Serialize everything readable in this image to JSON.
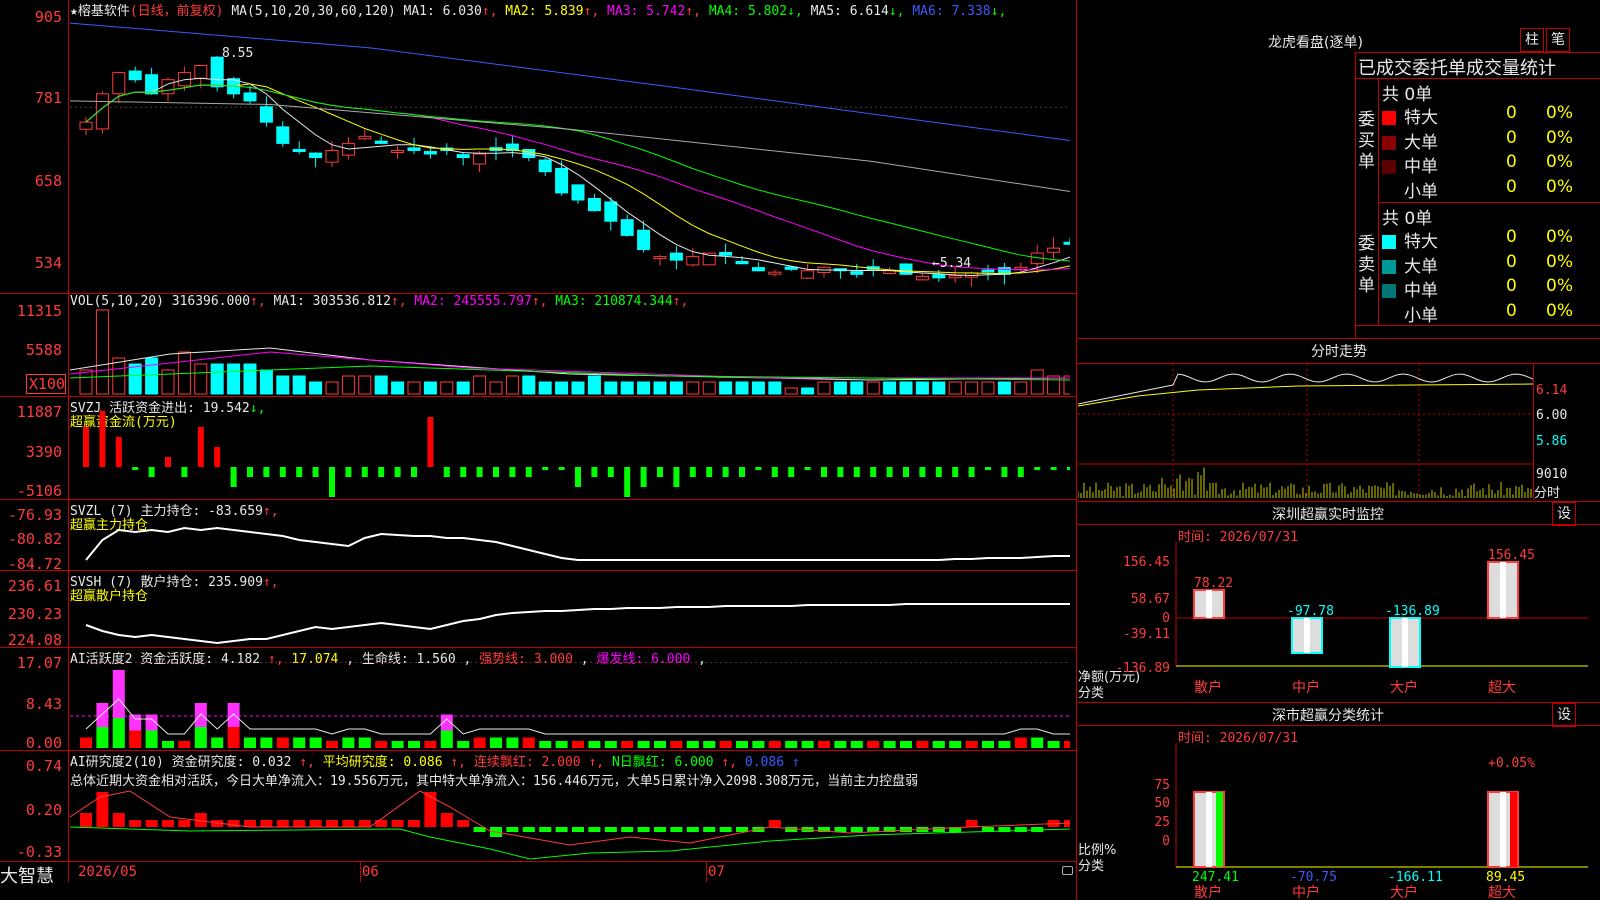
{
  "stock": {
    "name": "★榕基软件",
    "mode": "(日线，前复权)",
    "ma_label": "MA(5,10,20,30,60,120)",
    "ma": [
      {
        "k": "MA1:",
        "v": "6.030",
        "a": "↑",
        "color": "#e8e8e8"
      },
      {
        "k": "MA2:",
        "v": "5.839",
        "a": "↑",
        "color": "#ffff00"
      },
      {
        "k": "MA3:",
        "v": "5.742",
        "a": "↑",
        "color": "#ff00ff"
      },
      {
        "k": "MA4:",
        "v": "5.802",
        "a": "↓",
        "color": "#00ff00"
      },
      {
        "k": "MA5:",
        "v": "6.614",
        "a": "↓",
        "color": "#e8e8e8"
      },
      {
        "k": "MA6:",
        "v": "7.338",
        "a": "↓",
        "color": "#3b5bff"
      }
    ],
    "high_label": "8.55",
    "low_label": "←5.34"
  },
  "axes": {
    "price": [
      "905",
      "781",
      "658",
      "534"
    ],
    "vol": [
      "11315",
      "5588",
      "X100"
    ],
    "svzj": [
      "11887",
      "3390",
      "-5106"
    ],
    "svzl": [
      "-76.93",
      "-80.82",
      "-84.72"
    ],
    "svsh": [
      "236.61",
      "230.23",
      "224.08"
    ],
    "ai1": [
      "17.07",
      "8.43",
      "0.00"
    ],
    "ai2": [
      "0.74",
      "0.20",
      "-0.33"
    ]
  },
  "vol": {
    "label": "VOL(5,10,20)",
    "value": "316396.000",
    "ma": [
      {
        "k": "MA1:",
        "v": "303536.812",
        "a": "↑",
        "color": "#e8e8e8"
      },
      {
        "k": "MA2:",
        "v": "245555.797",
        "a": "↑",
        "color": "#ff00ff"
      },
      {
        "k": "MA3:",
        "v": "210874.344",
        "a": "↑",
        "color": "#00ff00"
      }
    ]
  },
  "svzj": {
    "l1": "SVZJ  活跃资金进出:",
    "v": "19.542",
    "a": "↓,",
    "l2": "超赢资金流(万元)"
  },
  "svzl": {
    "l1": "SVZL (7) 主力持仓:",
    "v": "-83.659",
    "a": "↑,",
    "l2": "超赢主力持仓"
  },
  "svsh": {
    "l1": "SVSH (7) 散户持仓:",
    "v": "235.909",
    "a": "↑,",
    "l2": "超赢散户持仓"
  },
  "ai1": {
    "items": [
      {
        "t": "AI活跃度2 资金活跃度:",
        "color": "#e8e8e8"
      },
      {
        "t": "4.182",
        "color": "#e8e8e8"
      },
      {
        "t": "↑,",
        "color": "#ff3b3b"
      },
      {
        "t": "17.074",
        "color": "#ffff00"
      },
      {
        "t": ",",
        "color": "#e8e8e8"
      },
      {
        "t": "生命线:",
        "color": "#e8e8e8"
      },
      {
        "t": "1.560",
        "color": "#e8e8e8"
      },
      {
        "t": ",",
        "color": "#e8e8e8"
      },
      {
        "t": "强势线:",
        "color": "#ff3b3b"
      },
      {
        "t": "3.000",
        "color": "#ff3b3b"
      },
      {
        "t": ",",
        "color": "#e8e8e8"
      },
      {
        "t": "爆发线:",
        "color": "#ff00ff"
      },
      {
        "t": "6.000",
        "color": "#ff00ff"
      },
      {
        "t": ",",
        "color": "#e8e8e8"
      }
    ]
  },
  "ai2": {
    "items": [
      {
        "t": "AI研究度2(10) 资金研究度:",
        "color": "#e8e8e8"
      },
      {
        "t": "0.032",
        "color": "#e8e8e8"
      },
      {
        "t": "↑,",
        "color": "#ff3b3b"
      },
      {
        "t": "平均研究度:",
        "color": "#ffff00"
      },
      {
        "t": "0.086",
        "color": "#ffff00"
      },
      {
        "t": "↑,",
        "color": "#ff3b3b"
      },
      {
        "t": "连续飘红:",
        "color": "#ff3b3b"
      },
      {
        "t": "2.000",
        "color": "#ff3b3b"
      },
      {
        "t": "↑,",
        "color": "#ff3b3b"
      },
      {
        "t": "N日飘红:",
        "color": "#00ff00"
      },
      {
        "t": "6.000",
        "color": "#00ff00"
      },
      {
        "t": "↑,",
        "color": "#ff3b3b"
      },
      {
        "t": "0.086",
        "color": "#3b5bff"
      },
      {
        "t": "↑",
        "color": "#3b5bff"
      }
    ],
    "summary": "总体近期大资金相对活跃，今日大单净流入：19.556万元，其中特大单净流入：156.446万元，大单5日累计净入2098.308万元，当前主力控盘弱"
  },
  "xaxis": {
    "logo": "大智慧",
    "m1": "2026/05",
    "m2": "06",
    "m3": "07"
  },
  "dragon": {
    "title": "龙虎看盘(逐单)",
    "btn1": "柱",
    "btn2": "笔",
    "sub": "已成交委托单成交量统计",
    "buy_side": "委买单",
    "sell_side": "委卖单",
    "buy_total": "共 0单",
    "sell_total": "共 0单",
    "buy_rows": [
      {
        "label": "特大",
        "count": "0",
        "pct": "0%",
        "color": "#ff0000"
      },
      {
        "label": "大单",
        "count": "0",
        "pct": "0%",
        "color": "#8b0000"
      },
      {
        "label": "中单",
        "count": "0",
        "pct": "0%",
        "color": "#5a0000"
      },
      {
        "label": "小单",
        "count": "0",
        "pct": "0%",
        "color": ""
      }
    ],
    "sell_rows": [
      {
        "label": "特大",
        "count": "0",
        "pct": "0%",
        "color": "#00ffff"
      },
      {
        "label": "大单",
        "count": "0",
        "pct": "0%",
        "color": "#009999"
      },
      {
        "label": "中单",
        "count": "0",
        "pct": "0%",
        "color": "#007777"
      },
      {
        "label": "小单",
        "count": "0",
        "pct": "0%",
        "color": ""
      }
    ]
  },
  "intraday": {
    "title": "分时走势",
    "p1": "6.14",
    "p2": "6.00",
    "p3": "5.86",
    "v": "9010",
    "vu": "分时"
  },
  "monitor": {
    "title": "深圳超赢实时监控",
    "btn": "设",
    "time": "时间: 2026/07/31",
    "yticks": [
      "156.45",
      "58.67",
      "0",
      "-39.11",
      "-136.89"
    ],
    "ylabel": "净额(万元)",
    "xlabel": "分类",
    "bars": [
      {
        "cat": "散户",
        "value": 78.22,
        "label": "78.22",
        "color": "#ff3b3b"
      },
      {
        "cat": "中户",
        "value": -97.78,
        "label": "-97.78",
        "color": "#00ffff"
      },
      {
        "cat": "大户",
        "value": -136.89,
        "label": "-136.89",
        "color": "#00ffff"
      },
      {
        "cat": "超大",
        "value": 156.45,
        "label": "156.45",
        "color": "#ff3b3b"
      }
    ]
  },
  "classify": {
    "title": "深市超赢分类统计",
    "btn": "设",
    "time": "时间: 2026/07/31",
    "yticks": [
      "75",
      "50",
      "25",
      "0"
    ],
    "ylabel": "比例%",
    "xlabel": "分类",
    "top_label": "+0.05%",
    "bars": [
      {
        "cat": "散户",
        "label": "247.41",
        "pct": 100,
        "lcolor": "#00ff00"
      },
      {
        "cat": "中户",
        "label": "-70.75",
        "pct": 0,
        "lcolor": "#3b5bff"
      },
      {
        "cat": "大户",
        "label": "-166.11",
        "pct": 0,
        "lcolor": "#00ffff"
      },
      {
        "cat": "超大",
        "label": "89.45",
        "pct": 100,
        "lcolor": "#ffff00"
      }
    ]
  },
  "colors": {
    "up": "#ff3b3b",
    "down": "#00ffff",
    "grid": "#c00000"
  }
}
